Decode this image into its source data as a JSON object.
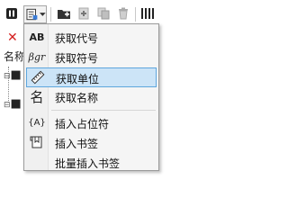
{
  "left_panel": {
    "close_glyph": "✕",
    "name_label": "名称",
    "tree_nodes": [
      "■",
      "■"
    ]
  },
  "toolbar": {
    "icons": [
      "bold-b-icon",
      "insert-field-icon",
      "new-folder-icon",
      "add-icon",
      "copy-icon",
      "delete-icon",
      "columns-icon"
    ]
  },
  "menu": {
    "items": [
      {
        "icon_text": "AB",
        "label": "获取代号"
      },
      {
        "icon_text": "βgr",
        "label": "获取符号"
      },
      {
        "icon_text": "",
        "label": "获取单位",
        "highlighted": true
      },
      {
        "icon_text": "名",
        "label": "获取名称"
      },
      {
        "icon_text": "{A}",
        "label": "插入占位符"
      },
      {
        "icon_text": "",
        "label": "插入书签"
      },
      {
        "icon_text": "",
        "label": "批量插入书签"
      }
    ]
  },
  "colors": {
    "highlight_bg": "#cce4f7",
    "highlight_border": "#5ea6dd",
    "close_red": "#d42020"
  }
}
